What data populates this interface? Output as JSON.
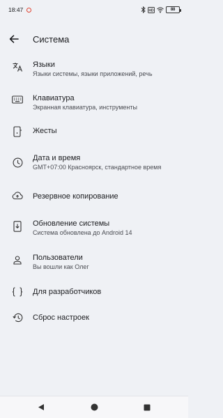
{
  "status_bar": {
    "time": "18:47",
    "battery": "88"
  },
  "header": {
    "title": "Система"
  },
  "items": [
    {
      "icon": "translate-icon",
      "title": "Языки",
      "subtitle": "Языки системы, языки приложений, речь"
    },
    {
      "icon": "keyboard-icon",
      "title": "Клавиатура",
      "subtitle": "Экранная клавиатура, инструменты"
    },
    {
      "icon": "gestures-icon",
      "title": "Жесты",
      "subtitle": ""
    },
    {
      "icon": "clock-icon",
      "title": "Дата и время",
      "subtitle": "GMT+07:00 Красноярск, стандартное время"
    },
    {
      "icon": "cloud-upload-icon",
      "title": "Резервное копирование",
      "subtitle": ""
    },
    {
      "icon": "system-update-icon",
      "title": "Обновление системы",
      "subtitle": "Система обновлена до Android 14"
    },
    {
      "icon": "person-icon",
      "title": "Пользователи",
      "subtitle": "Вы вошли как Олег"
    },
    {
      "icon": "braces-icon",
      "title": "Для разработчиков",
      "subtitle": ""
    },
    {
      "icon": "history-icon",
      "title": "Сброс настроек",
      "subtitle": ""
    }
  ]
}
